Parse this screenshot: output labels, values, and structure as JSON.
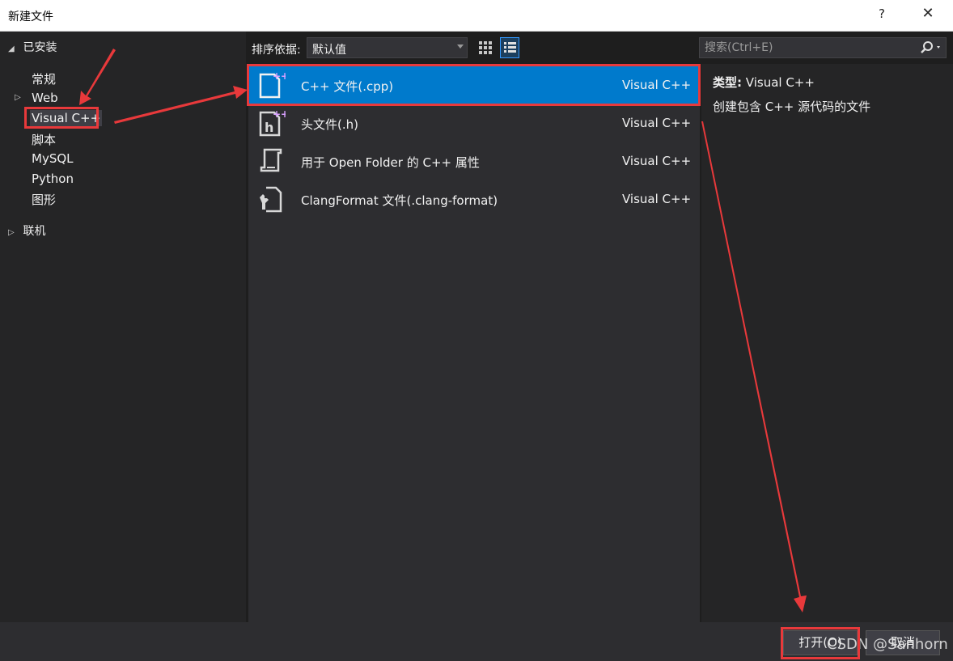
{
  "window": {
    "title": "新建文件",
    "help_label": "?",
    "close_label": "✕"
  },
  "tree": {
    "installed": {
      "arrow": "◢",
      "label": "已安装"
    },
    "items": [
      {
        "label": "常规",
        "expander": ""
      },
      {
        "label": "Web",
        "expander": "▷"
      },
      {
        "label": "Visual C++",
        "expander": "",
        "selected": true
      },
      {
        "label": "脚本",
        "expander": ""
      },
      {
        "label": "MySQL",
        "expander": ""
      },
      {
        "label": "Python",
        "expander": ""
      },
      {
        "label": "图形",
        "expander": ""
      }
    ],
    "online": {
      "arrow": "▷",
      "label": "联机"
    }
  },
  "toolbar": {
    "sort_label": "排序依据:",
    "sort_value": "默认值",
    "grid_view_icon": "grid-view-icon",
    "list_view_icon": "list-view-icon"
  },
  "search": {
    "placeholder": "搜索(Ctrl+E)",
    "icon": "search-icon"
  },
  "templates": [
    {
      "name": "C++ 文件(.cpp)",
      "type": "Visual C++",
      "icon": "cpp-file-icon",
      "selected": true
    },
    {
      "name": "头文件(.h)",
      "type": "Visual C++",
      "icon": "header-file-icon",
      "selected": false
    },
    {
      "name": "用于 Open Folder 的 C++ 属性",
      "type": "Visual C++",
      "icon": "properties-file-icon",
      "selected": false
    },
    {
      "name": "ClangFormat 文件(.clang-format)",
      "type": "Visual C++",
      "icon": "clang-format-file-icon",
      "selected": false
    }
  ],
  "details": {
    "type_label": "类型:",
    "type_value": "Visual C++",
    "description": "创建包含 C++ 源代码的文件"
  },
  "buttons": {
    "open": "打开(O)",
    "cancel": "取消"
  },
  "watermark": "CSDN @Sanhorn",
  "colors": {
    "selection": "#007acc",
    "annotation": "#e8393b",
    "accent": "#3399ff"
  }
}
